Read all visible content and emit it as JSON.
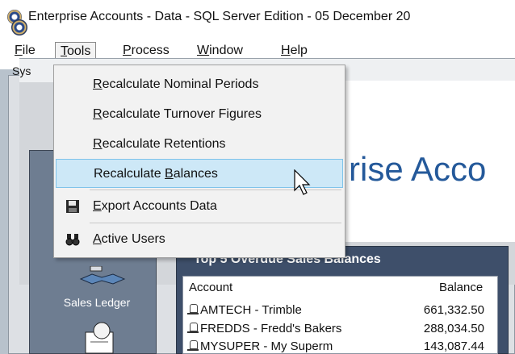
{
  "window": {
    "title": "Enterprise Accounts - Data - SQL Server Edition - 05 December 20"
  },
  "menubar": {
    "items": [
      {
        "key": "F",
        "rest": "ile"
      },
      {
        "key": "T",
        "rest": "ools"
      },
      {
        "key": "P",
        "rest": "rocess"
      },
      {
        "key": "W",
        "rest": "indow"
      },
      {
        "key": "H",
        "rest": "elp"
      }
    ]
  },
  "tools_menu": {
    "items": [
      {
        "pre": "",
        "key": "R",
        "post": "ecalculate Nominal Periods"
      },
      {
        "pre": "",
        "key": "R",
        "post": "ecalculate Turnover Figures"
      },
      {
        "pre": "",
        "key": "R",
        "post": "ecalculate Retentions"
      },
      {
        "pre": "Recalculate ",
        "key": "B",
        "post": "alances"
      },
      {
        "pre": "",
        "key": "E",
        "post": "xport Accounts Data"
      },
      {
        "pre": "",
        "key": "A",
        "post": "ctive Users"
      }
    ],
    "hovered_index": 3,
    "icons": {
      "export": "floppy-disk-icon",
      "users": "binoculars-icon"
    }
  },
  "child_window": {
    "tab_label": "Sys",
    "banner": "rise Acco",
    "sidebar_label": "Sales Ledger"
  },
  "overdue_widget": {
    "title": "Top 5 Overdue Sales Balances",
    "col_account": "Account",
    "col_balance": "Balance",
    "rows": [
      {
        "account": "AMTECH - Trimble",
        "balance": "661,332.50"
      },
      {
        "account": "FREDDS - Fredd's Bakers",
        "balance": "288,034.50"
      },
      {
        "account": "MYSUPER - My Superm",
        "balance": "143,087.44"
      }
    ]
  },
  "colors": {
    "highlight": "#cde8f7",
    "highlight_border": "#7ec3ea",
    "banner_text": "#24599a",
    "panel": "#6e7d91"
  }
}
